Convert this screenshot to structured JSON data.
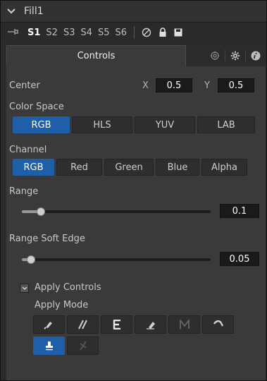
{
  "header": {
    "title": "Fill1"
  },
  "toolbar": {
    "slots": [
      "S1",
      "S2",
      "S3",
      "S4",
      "S5",
      "S6"
    ],
    "active_slot": "S1"
  },
  "tabs": {
    "controls_label": "Controls"
  },
  "center": {
    "label": "Center",
    "x_label": "X",
    "x_value": "0.5",
    "y_label": "Y",
    "y_value": "0.5"
  },
  "color_space": {
    "label": "Color Space",
    "options": [
      "RGB",
      "HLS",
      "YUV",
      "LAB"
    ],
    "selected": "RGB"
  },
  "channel": {
    "label": "Channel",
    "options": [
      "RGB",
      "Red",
      "Green",
      "Blue",
      "Alpha"
    ],
    "selected": "RGB"
  },
  "range": {
    "label": "Range",
    "value": "0.1",
    "level": 0.1
  },
  "range_soft_edge": {
    "label": "Range Soft Edge",
    "value": "0.05",
    "level": 0.05
  },
  "apply": {
    "controls_label": "Apply Controls",
    "mode_label": "Apply Mode"
  },
  "colors": {
    "accent": "#1f5ea8",
    "panel": "#3a3a3a",
    "field": "#1a1a1a"
  }
}
